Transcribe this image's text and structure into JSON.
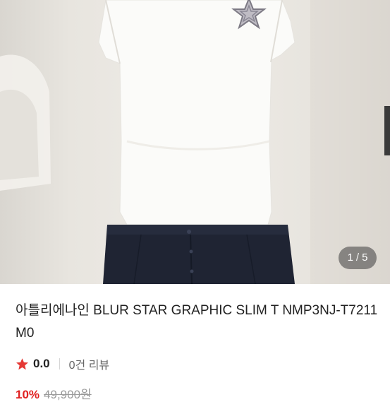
{
  "gallery": {
    "current": "1",
    "separator": "/",
    "total": "5"
  },
  "product": {
    "title": "아틀리에나인 BLUR STAR GRAPHIC SLIM T NMP3NJ-T7211M0",
    "rating": "0.0",
    "review_count": "0건 리뷰",
    "discount": "10%",
    "original_price": "49,900원"
  },
  "colors": {
    "star": "#e53935",
    "discount": "#e02020"
  },
  "icons": {
    "rating": "star-icon"
  }
}
